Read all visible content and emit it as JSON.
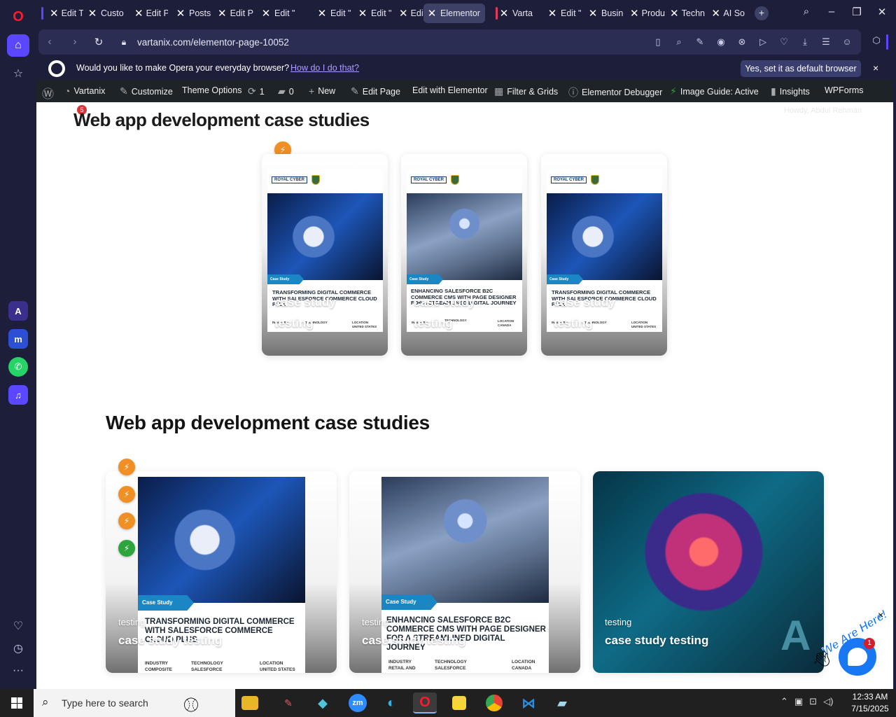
{
  "browser": {
    "tabs": [
      {
        "label": "Edit T"
      },
      {
        "label": "Custo"
      },
      {
        "label": "Edit P"
      },
      {
        "label": "Posts"
      },
      {
        "label": "Edit P"
      },
      {
        "label": "Edit \""
      },
      {
        "label": "Edit \""
      },
      {
        "label": "Edit \""
      },
      {
        "label": "Edit \""
      },
      {
        "label": "Elementor"
      },
      {
        "label": "Varta"
      },
      {
        "label": "Edit \""
      },
      {
        "label": "Busin"
      },
      {
        "label": "Produ"
      },
      {
        "label": "Techn"
      },
      {
        "label": "AI So"
      }
    ],
    "active_tab_index": 9,
    "url": "vartanix.com/elementor-page-10052",
    "default_prompt": {
      "question": "Would you like to make Opera your everyday browser?",
      "how_link": "How do I do that?",
      "yes_button": "Yes, set it as default browser",
      "close": "×"
    }
  },
  "wp_admin_bar": {
    "site": "Vartanix",
    "customize": "Customize",
    "theme_options": "Theme Options",
    "updates": "1",
    "comments": "0",
    "new": "New",
    "edit_page": "Edit Page",
    "edit_elementor": "Edit with Elementor",
    "filter_grids": "Filter & Grids",
    "elementor_debugger": "Elementor Debugger",
    "image_guide": "Image Guide: Active",
    "insights": "Insights",
    "wpforms": "WPForms",
    "seo_badge": "5",
    "howdy": "Howdy, Abdul Rehman"
  },
  "sections": [
    {
      "title": "Web app development case studies",
      "cards": [
        {
          "tag": "Case Study",
          "cover_title": "Transforming Digital Commerce with Salesforce Commerce Cloud Plus",
          "meta": [
            "Industry",
            "Technology",
            "Location",
            "United States"
          ],
          "overlay_top": "case study",
          "overlay_bottom": "testing"
        },
        {
          "tag": "Case Study",
          "cover_title": "Enhancing Salesforce B2C Commerce CMS with Page Designer for a Streamlined Digital Journey",
          "meta": [
            "Industry",
            "Technology",
            "Location",
            "Canada"
          ],
          "overlay_top": "case study",
          "overlay_bottom": "testing"
        },
        {
          "tag": "Case Study",
          "cover_title": "Transforming Digital Commerce with Salesforce Commerce Cloud Plus",
          "meta": [
            "Industry",
            "Technology",
            "Location",
            "United States"
          ],
          "overlay_top": "case study",
          "overlay_bottom": "testing"
        }
      ]
    },
    {
      "title": "Web app development case studies",
      "cards": [
        {
          "tag": "Case Study",
          "cover_title": "Transforming Digital Commerce with Salesforce Commerce Cloud Plus",
          "meta": [
            "Industry",
            "Technology",
            "Location",
            "Composite",
            "Salesforce",
            "United States"
          ],
          "label": "testing",
          "caption": "case study testing"
        },
        {
          "tag": "Case Study",
          "cover_title": "Enhancing Salesforce B2C Commerce CMS with Page Designer for a Streamlined Digital Journey",
          "meta": [
            "Industry",
            "Technology",
            "Location",
            "Retail and",
            "Salesforce",
            "Canada"
          ],
          "label": "testing",
          "caption": "case study testing"
        },
        {
          "label": "testing",
          "caption": "case study testing"
        }
      ]
    }
  ],
  "chat": {
    "badge": "1",
    "headline": "We Are Here!",
    "close": "×"
  },
  "taskbar": {
    "search_placeholder": "Type here to search",
    "time": "12:33 AM",
    "date": "7/15/2025"
  },
  "colors": {
    "accent": "#5b47ff",
    "elementor_orange": "#ef8f24",
    "elementor_green": "#2ea43e",
    "case_tag": "#1b86c4"
  }
}
